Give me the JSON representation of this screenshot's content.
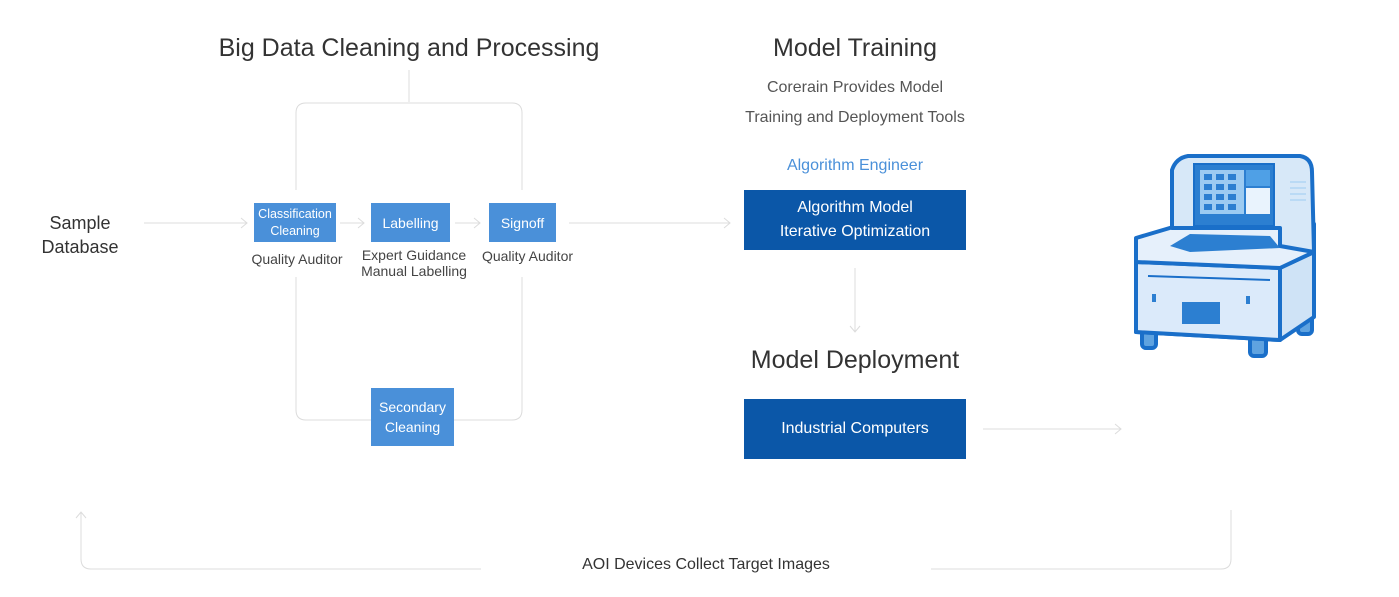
{
  "diagram": {
    "sample_database": {
      "line1": "Sample",
      "line2": "Database"
    },
    "cleaning_section": {
      "title": "Big Data Cleaning and Processing",
      "steps": [
        {
          "label_line1": "Classification",
          "label_line2": "Cleaning",
          "role": "Quality Auditor"
        },
        {
          "label": "Labelling",
          "role_line1": "Expert Guidance",
          "role_line2": "Manual Labelling"
        },
        {
          "label": "Signoff",
          "role": "Quality Auditor"
        }
      ],
      "secondary": {
        "line1": "Secondary",
        "line2": "Cleaning"
      }
    },
    "training_section": {
      "title": "Model Training",
      "subtitle_line1": "Corerain Provides Model",
      "subtitle_line2": "Training and Deployment Tools",
      "role": "Algorithm Engineer",
      "box": {
        "line1": "Algorithm Model",
        "line2": "Iterative Optimization"
      }
    },
    "deployment_section": {
      "title": "Model Deployment",
      "box": "Industrial Computers"
    },
    "device_image": "aoi-machine-image",
    "loop_label": "AOI Devices Collect Target Images",
    "colors": {
      "light_box": "#4a90d9",
      "dark_box": "#0b57a8",
      "accent_text": "#4a90d9",
      "line": "#dddddd"
    }
  }
}
